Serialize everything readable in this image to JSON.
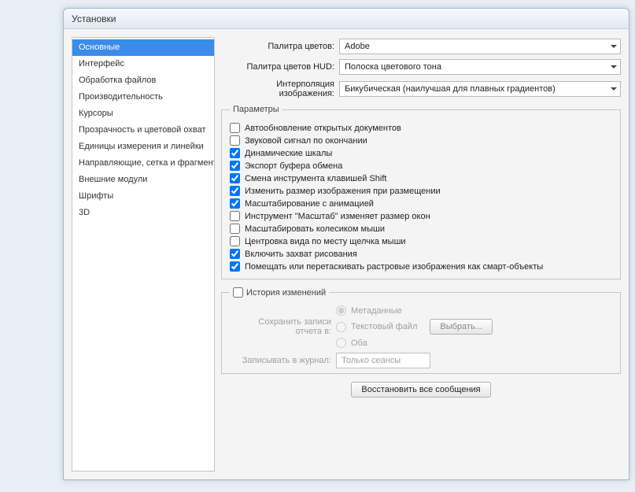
{
  "window": {
    "title": "Установки"
  },
  "sidebar": {
    "items": [
      "Основные",
      "Интерфейс",
      "Обработка файлов",
      "Производительность",
      "Курсоры",
      "Прозрачность и цветовой охват",
      "Единицы измерения и линейки",
      "Направляющие, сетка и фрагменты",
      "Внешние модули",
      "Шрифты",
      "3D"
    ],
    "selected": 0
  },
  "dropdowns": {
    "palette_label": "Палитра цветов:",
    "palette_value": "Adobe",
    "hud_label": "Палитра цветов HUD:",
    "hud_value": "Полоска цветового тона",
    "interp_label": "Интерполяция изображения:",
    "interp_value": "Бикубическая (наилучшая для плавных градиентов)"
  },
  "params": {
    "legend": "Параметры",
    "items": [
      {
        "label": "Автообновление открытых документов",
        "checked": false
      },
      {
        "label": "Звуковой сигнал по окончании",
        "checked": false
      },
      {
        "label": "Динамические шкалы",
        "checked": true
      },
      {
        "label": "Экспорт буфера обмена",
        "checked": true
      },
      {
        "label": "Смена инструмента клавишей Shift",
        "checked": true
      },
      {
        "label": "Изменить размер изображения при размещении",
        "checked": true
      },
      {
        "label": "Масштабирование с анимацией",
        "checked": true
      },
      {
        "label": "Инструмент \"Масштаб\" изменяет размер окон",
        "checked": false
      },
      {
        "label": "Масштабировать колесиком мыши",
        "checked": false
      },
      {
        "label": "Центровка вида по месту щелчка мыши",
        "checked": false
      },
      {
        "label": "Включить захват рисования",
        "checked": true
      },
      {
        "label": "Помещать или перетаскивать растровые изображения как смарт-объекты",
        "checked": true
      }
    ]
  },
  "history": {
    "legend_checkbox_checked": false,
    "legend_text": "История изменений",
    "save_label": "Сохранить записи отчета в:",
    "radio1": "Метаданные",
    "radio2": "Текстовый файл",
    "choose_btn": "Выбрать...",
    "radio3": "Оба",
    "journal_label": "Записывать в журнал:",
    "journal_value": "Только сеансы"
  },
  "restore_btn": "Восстановить все сообщения"
}
